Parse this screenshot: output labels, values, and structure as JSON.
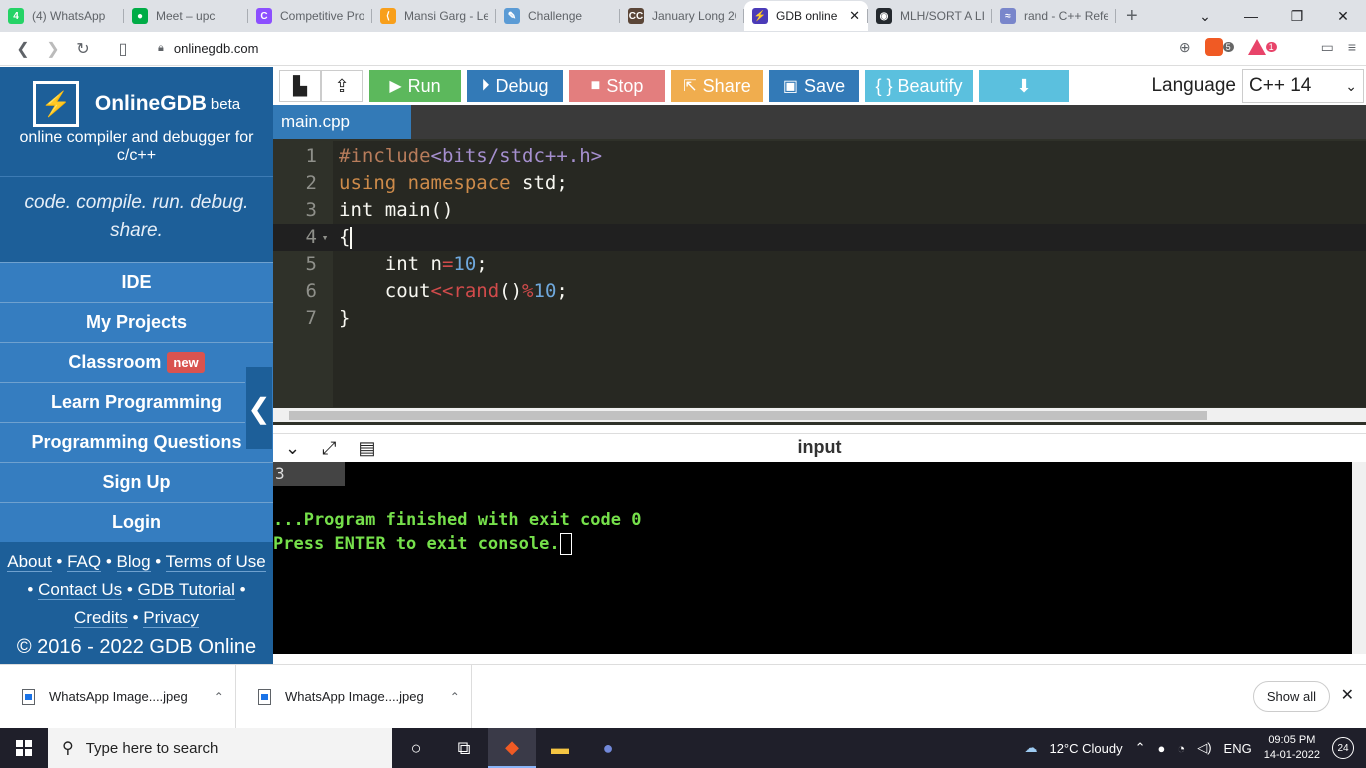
{
  "browser": {
    "tabs": [
      {
        "title": "(4) WhatsApp",
        "color": "#25d366",
        "glyph": "4"
      },
      {
        "title": "Meet – upc",
        "color": "#00ac47",
        "glyph": "●"
      },
      {
        "title": "Competitive Pro",
        "color": "#8c4fff",
        "glyph": "C"
      },
      {
        "title": "Mansi Garg - Le",
        "color": "#f89f1b",
        "glyph": "⟨"
      },
      {
        "title": "Challenge",
        "color": "#5b9bd5",
        "glyph": "✎"
      },
      {
        "title": "January Long 20",
        "color": "#5b4638",
        "glyph": "CC"
      },
      {
        "title": "GDB online",
        "color": "#4b3bb8",
        "glyph": "⚡"
      },
      {
        "title": "MLH/SORT A LIS",
        "color": "#24292e",
        "glyph": "◉"
      },
      {
        "title": "rand - C++ Refe",
        "color": "#7986cb",
        "glyph": "≈"
      }
    ],
    "active_tab": 6,
    "new_tab": "+",
    "url": "onlinegdb.com",
    "brave_count": "5",
    "rewards_count": "1"
  },
  "sidebar": {
    "brand": "OnlineGDB",
    "beta": "beta",
    "subtitle": "online compiler and debugger for c/c++",
    "tagline": "code. compile. run. debug. share.",
    "menu": [
      {
        "label": "IDE"
      },
      {
        "label": "My Projects"
      },
      {
        "label": "Classroom",
        "badge": "new"
      },
      {
        "label": "Learn Programming"
      },
      {
        "label": "Programming Questions"
      },
      {
        "label": "Sign Up"
      },
      {
        "label": "Login"
      }
    ],
    "links": [
      "About",
      "FAQ",
      "Blog",
      "Terms of Use",
      "Contact Us",
      "GDB Tutorial",
      "Credits",
      "Privacy"
    ],
    "copyright": "© 2016 - 2022 GDB Online"
  },
  "toolbar": {
    "run": "Run",
    "debug": "Debug",
    "stop": "Stop",
    "share": "Share",
    "save": "Save",
    "beautify": "{ } Beautify",
    "language_label": "Language",
    "language_value": "C++ 14"
  },
  "editor": {
    "file_tab": "main.cpp",
    "line_numbers": [
      "1",
      "2",
      "3",
      "4",
      "5",
      "6",
      "7"
    ]
  },
  "console": {
    "title": "input",
    "input_value": "3",
    "line1": "...Program finished with exit code 0",
    "line2": "Press ENTER to exit console."
  },
  "downloads": {
    "items": [
      {
        "name": "WhatsApp Image....jpeg"
      },
      {
        "name": "WhatsApp Image....jpeg"
      }
    ],
    "show_all": "Show all"
  },
  "taskbar": {
    "search_placeholder": "Type here to search",
    "weather": "12°C  Cloudy",
    "lang": "ENG",
    "time": "09:05 PM",
    "date": "14-01-2022",
    "notifications": "24"
  }
}
